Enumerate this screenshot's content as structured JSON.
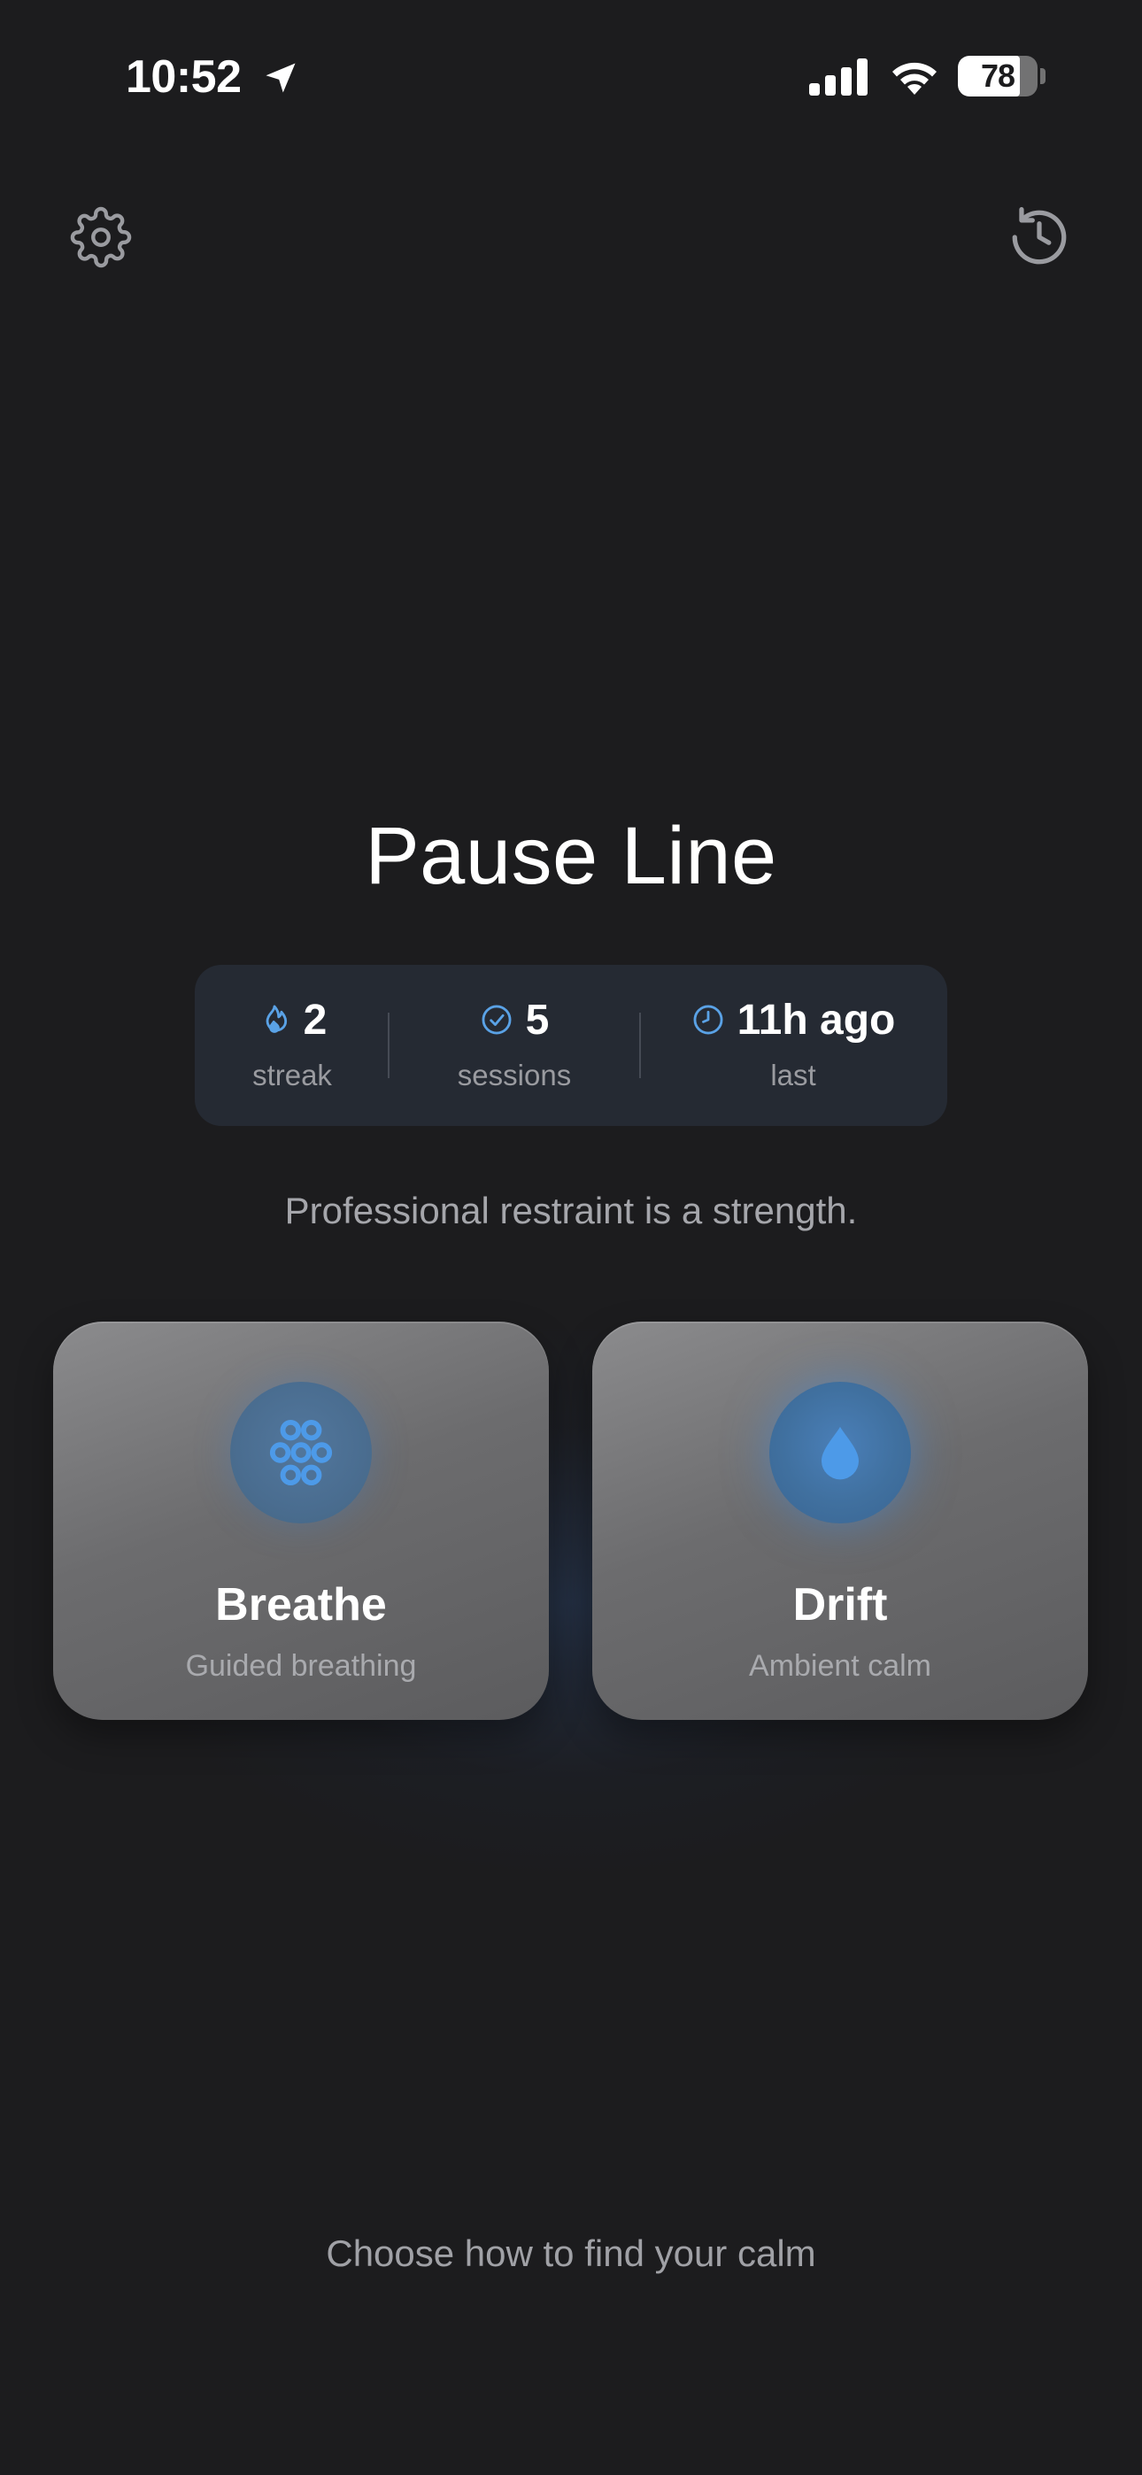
{
  "status_bar": {
    "time": "10:52",
    "battery_level": "78",
    "icons": [
      "location-arrow-icon",
      "cellular-signal-icon",
      "wifi-icon",
      "battery-icon"
    ]
  },
  "toolbar": {
    "settings_icon": "gear-icon",
    "history_icon": "history-clock-icon"
  },
  "app": {
    "title": "Pause Line"
  },
  "stats": {
    "streak": {
      "value": "2",
      "label": "streak",
      "icon": "flame-icon"
    },
    "sessions": {
      "value": "5",
      "label": "sessions",
      "icon": "checkmark-circle-icon"
    },
    "last": {
      "value": "11h ago",
      "label": "last",
      "icon": "clock-icon"
    }
  },
  "motto": "Professional restraint is a strength.",
  "modes": {
    "breathe": {
      "title": "Breathe",
      "subtitle": "Guided breathing",
      "icon": "flower-dots-icon"
    },
    "drift": {
      "title": "Drift",
      "subtitle": "Ambient calm",
      "icon": "water-drop-icon"
    }
  },
  "footer": {
    "hint": "Choose how to find your calm"
  },
  "colors": {
    "background": "#1c1c1e",
    "accent_blue": "#4a90d9",
    "stats_card": "#252a33",
    "muted_text": "#9a9ba0"
  }
}
